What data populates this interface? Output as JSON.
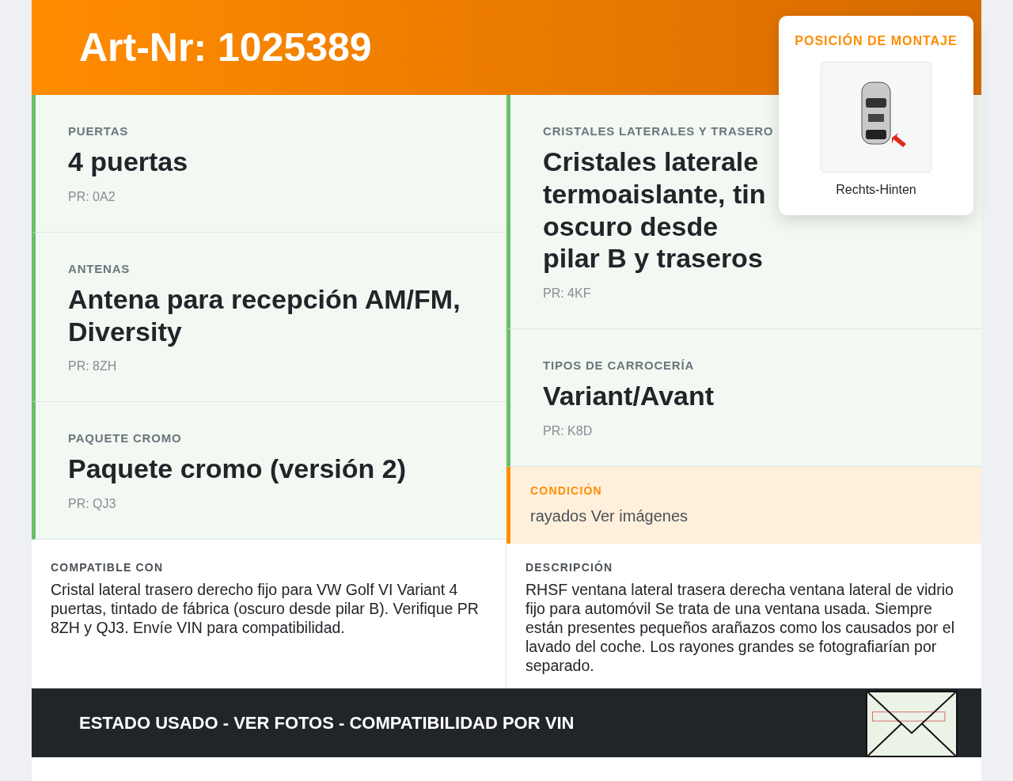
{
  "header": {
    "title": "Art-Nr: 1025389"
  },
  "mounting_position": {
    "title": "POSICIÓN DE MONTAJE",
    "caption": "Rechts-Hinten"
  },
  "features_left": [
    {
      "label": "PUERTAS",
      "value": "4 puertas",
      "code": "PR: 0A2"
    },
    {
      "label": "ANTENAS",
      "value": "Antena para recepción AM/FM, Diversity",
      "code": "PR: 8ZH"
    },
    {
      "label": "PAQUETE CROMO",
      "value": "Paquete cromo (versión 2)",
      "code": "PR: QJ3"
    }
  ],
  "features_right": [
    {
      "label": "CRISTALES LATERALES Y TRASERO",
      "value": "Cristales laterale termoaislante, tin oscuro desde pilar B y traseros",
      "code": "PR: 4KF"
    },
    {
      "label": "TIPOS DE CARROCERÍA",
      "value": "Variant/Avant",
      "code": "PR: K8D"
    }
  ],
  "condition": {
    "label": "CONDICIÓN",
    "text": "rayados Ver imágenes"
  },
  "compatible": {
    "label": "COMPATIBLE CON",
    "text": "Cristal lateral trasero derecho fijo para VW Golf VI Variant 4 puertas, tintado de fábrica (oscuro desde pilar B). Verifique PR 8ZH y QJ3. Envíe VIN para compatibilidad."
  },
  "description": {
    "label": "DESCRIPCIÓN",
    "text": "RHSF ventana lateral trasera derecha ventana lateral de vidrio fijo para automóvil Se trata de una ventana usada. Siempre están presentes pequeños arañazos como los causados por el lavado del coche. Los rayones grandes se fotografiarían por separado."
  },
  "footer": {
    "text": "ESTADO USADO - VER FOTOS - COMPATIBILIDAD POR VIN"
  }
}
